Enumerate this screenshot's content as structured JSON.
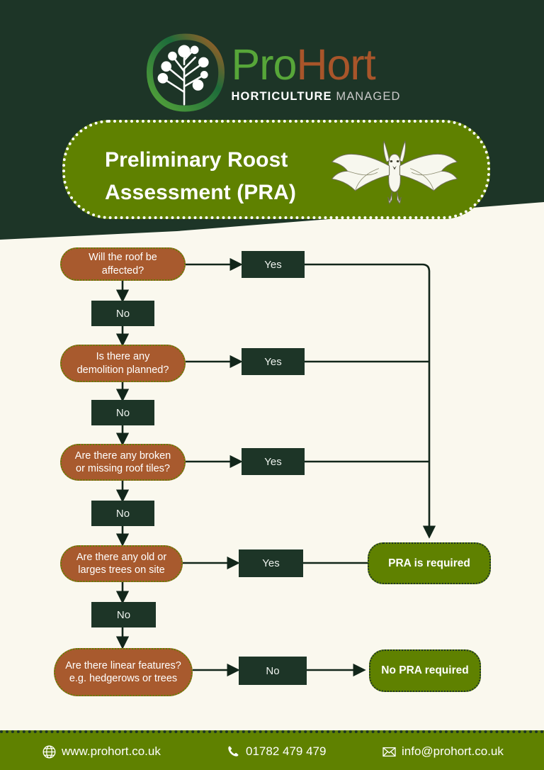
{
  "brand": {
    "name_part1": "Pro",
    "name_part2": "Hort",
    "tagline_bold": "HORTICULTURE",
    "tagline_light": "MANAGED",
    "logo_icon": "tree-network-circle-icon",
    "colors": {
      "dark_green": "#1d3527",
      "olive_green": "#5f8100",
      "brown": "#a85a2e",
      "cream": "#faf8ee",
      "logo_pro_green": "#57a639",
      "logo_hort_orange": "#a8552a"
    }
  },
  "title": {
    "line1": "Preliminary Roost",
    "line2": "Assessment (PRA)",
    "illustration": "bat-icon"
  },
  "flowchart": {
    "type": "decision-flowchart",
    "questions": [
      {
        "id": "q1",
        "text_line1": "Will the roof be",
        "text_line2": "affected?"
      },
      {
        "id": "q2",
        "text_line1": "Is there any",
        "text_line2": "demolition planned?"
      },
      {
        "id": "q3",
        "text_line1": "Are there any broken",
        "text_line2": "or missing roof tiles?"
      },
      {
        "id": "q4",
        "text_line1": "Are there any old or",
        "text_line2": "larges trees on site"
      },
      {
        "id": "q5",
        "text_line1": "Are there linear features?",
        "text_line2": "e.g. hedgerows or trees"
      }
    ],
    "yes_labels": [
      "Yes",
      "Yes",
      "Yes",
      "Yes"
    ],
    "no_labels": [
      "No",
      "No",
      "No",
      "No"
    ],
    "bottom_answer": "No",
    "results": [
      {
        "id": "r1",
        "text": "PRA is required"
      },
      {
        "id": "r2",
        "text": "No PRA required"
      }
    ]
  },
  "footer": {
    "website": "www.prohort.co.uk",
    "phone": "01782 479 479",
    "email": "info@prohort.co.uk",
    "website_icon": "globe-icon",
    "phone_icon": "phone-icon",
    "email_icon": "envelope-icon"
  }
}
